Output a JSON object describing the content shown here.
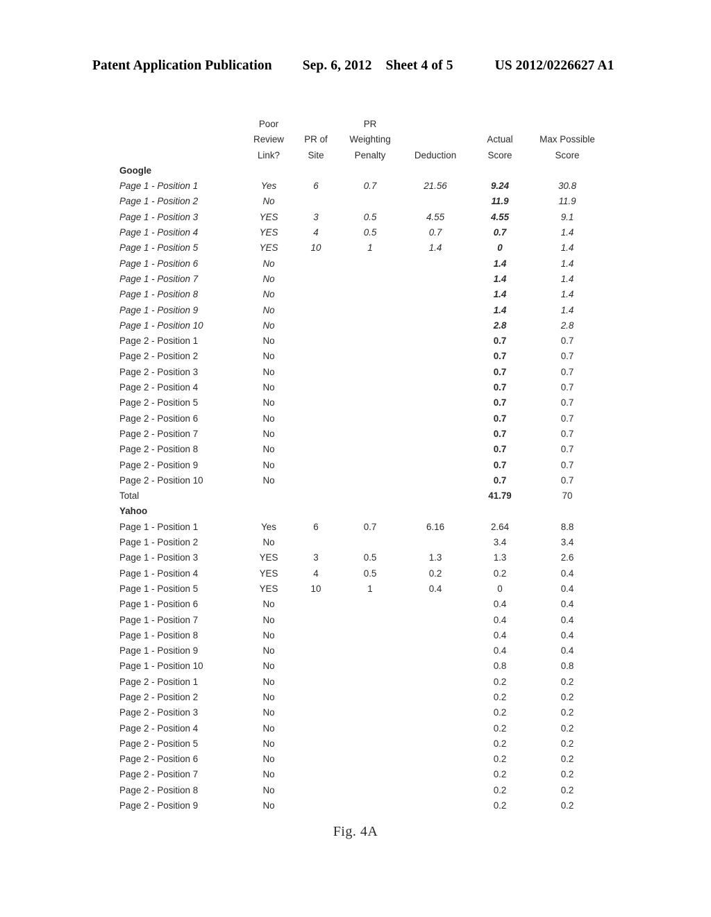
{
  "patent_header": {
    "publication": "Patent Application Publication",
    "date": "Sep. 6, 2012",
    "sheet": "Sheet 4 of 5",
    "publication_number": "US 2012/0226627 A1"
  },
  "figure": {
    "caption": "Fig. 4A"
  },
  "table": {
    "columns": [
      {
        "key": "label",
        "header_lines": [
          "",
          "",
          ""
        ]
      },
      {
        "key": "poor_review",
        "header_lines": [
          "Poor",
          "Review",
          "Link?"
        ]
      },
      {
        "key": "pr_of_site",
        "header_lines": [
          "",
          "PR of",
          "Site"
        ]
      },
      {
        "key": "pr_weight",
        "header_lines": [
          "PR",
          "Weighting",
          "Penalty"
        ]
      },
      {
        "key": "deduction",
        "header_lines": [
          "",
          "",
          "Deduction"
        ]
      },
      {
        "key": "actual",
        "header_lines": [
          "",
          "Actual",
          "Score"
        ]
      },
      {
        "key": "max",
        "header_lines": [
          "",
          "Max Possible",
          "Score"
        ]
      }
    ],
    "rows": [
      {
        "style": "section",
        "label": "Google",
        "poor_review": "",
        "pr_of_site": "",
        "pr_weight": "",
        "deduction": "",
        "actual": "",
        "max": ""
      },
      {
        "style": "italic",
        "bold_actual": true,
        "label": "Page 1 - Position 1",
        "poor_review": "Yes",
        "pr_of_site": "6",
        "pr_weight": "0.7",
        "deduction": "21.56",
        "actual": "9.24",
        "max": "30.8"
      },
      {
        "style": "italic",
        "bold_actual": true,
        "label": "Page 1 - Position 2",
        "poor_review": "No",
        "pr_of_site": "",
        "pr_weight": "",
        "deduction": "",
        "actual": "11.9",
        "max": "11.9"
      },
      {
        "style": "italic",
        "bold_actual": true,
        "label": "Page 1 - Position 3",
        "poor_review": "YES",
        "pr_of_site": "3",
        "pr_weight": "0.5",
        "deduction": "4.55",
        "actual": "4.55",
        "max": "9.1"
      },
      {
        "style": "italic",
        "bold_actual": true,
        "label": "Page 1 - Position 4",
        "poor_review": "YES",
        "pr_of_site": "4",
        "pr_weight": "0.5",
        "deduction": "0.7",
        "actual": "0.7",
        "max": "1.4"
      },
      {
        "style": "italic",
        "bold_actual": true,
        "label": "Page 1 - Position 5",
        "poor_review": "YES",
        "pr_of_site": "10",
        "pr_weight": "1",
        "deduction": "1.4",
        "actual": "0",
        "max": "1.4"
      },
      {
        "style": "italic",
        "bold_actual": true,
        "label": "Page 1 - Position 6",
        "poor_review": "No",
        "pr_of_site": "",
        "pr_weight": "",
        "deduction": "",
        "actual": "1.4",
        "max": "1.4"
      },
      {
        "style": "italic",
        "bold_actual": true,
        "label": "Page 1 - Position 7",
        "poor_review": "No",
        "pr_of_site": "",
        "pr_weight": "",
        "deduction": "",
        "actual": "1.4",
        "max": "1.4"
      },
      {
        "style": "italic",
        "bold_actual": true,
        "label": "Page 1 - Position 8",
        "poor_review": "No",
        "pr_of_site": "",
        "pr_weight": "",
        "deduction": "",
        "actual": "1.4",
        "max": "1.4"
      },
      {
        "style": "italic",
        "bold_actual": true,
        "label": "Page 1 - Position 9",
        "poor_review": "No",
        "pr_of_site": "",
        "pr_weight": "",
        "deduction": "",
        "actual": "1.4",
        "max": "1.4"
      },
      {
        "style": "italic",
        "bold_actual": true,
        "label": "Page 1 - Position 10",
        "poor_review": "No",
        "pr_of_site": "",
        "pr_weight": "",
        "deduction": "",
        "actual": "2.8",
        "max": "2.8"
      },
      {
        "style": "plain",
        "bold_actual": true,
        "label": "Page 2 - Position 1",
        "poor_review": "No",
        "pr_of_site": "",
        "pr_weight": "",
        "deduction": "",
        "actual": "0.7",
        "max": "0.7"
      },
      {
        "style": "plain",
        "bold_actual": true,
        "label": "Page 2 - Position 2",
        "poor_review": "No",
        "pr_of_site": "",
        "pr_weight": "",
        "deduction": "",
        "actual": "0.7",
        "max": "0.7"
      },
      {
        "style": "plain",
        "bold_actual": true,
        "label": "Page 2 - Position 3",
        "poor_review": "No",
        "pr_of_site": "",
        "pr_weight": "",
        "deduction": "",
        "actual": "0.7",
        "max": "0.7"
      },
      {
        "style": "plain",
        "bold_actual": true,
        "label": "Page 2 - Position 4",
        "poor_review": "No",
        "pr_of_site": "",
        "pr_weight": "",
        "deduction": "",
        "actual": "0.7",
        "max": "0.7"
      },
      {
        "style": "plain",
        "bold_actual": true,
        "label": "Page 2 - Position 5",
        "poor_review": "No",
        "pr_of_site": "",
        "pr_weight": "",
        "deduction": "",
        "actual": "0.7",
        "max": "0.7"
      },
      {
        "style": "plain",
        "bold_actual": true,
        "label": "Page 2 - Position 6",
        "poor_review": "No",
        "pr_of_site": "",
        "pr_weight": "",
        "deduction": "",
        "actual": "0.7",
        "max": "0.7"
      },
      {
        "style": "plain",
        "bold_actual": true,
        "label": "Page 2 - Position 7",
        "poor_review": "No",
        "pr_of_site": "",
        "pr_weight": "",
        "deduction": "",
        "actual": "0.7",
        "max": "0.7"
      },
      {
        "style": "plain",
        "bold_actual": true,
        "label": "Page 2 - Position 8",
        "poor_review": "No",
        "pr_of_site": "",
        "pr_weight": "",
        "deduction": "",
        "actual": "0.7",
        "max": "0.7"
      },
      {
        "style": "plain",
        "bold_actual": true,
        "label": "Page 2 - Position 9",
        "poor_review": "No",
        "pr_of_site": "",
        "pr_weight": "",
        "deduction": "",
        "actual": "0.7",
        "max": "0.7"
      },
      {
        "style": "plain",
        "bold_actual": true,
        "label": "Page 2 - Position 10",
        "poor_review": "No",
        "pr_of_site": "",
        "pr_weight": "",
        "deduction": "",
        "actual": "0.7",
        "max": "0.7"
      },
      {
        "style": "plain",
        "bold_actual": true,
        "label": "Total",
        "poor_review": "",
        "pr_of_site": "",
        "pr_weight": "",
        "deduction": "",
        "actual": "41.79",
        "max": "70"
      },
      {
        "style": "section",
        "label": "Yahoo",
        "poor_review": "",
        "pr_of_site": "",
        "pr_weight": "",
        "deduction": "",
        "actual": "",
        "max": ""
      },
      {
        "style": "plain",
        "label": "Page 1 - Position 1",
        "poor_review": "Yes",
        "pr_of_site": "6",
        "pr_weight": "0.7",
        "deduction": "6.16",
        "actual": "2.64",
        "max": "8.8"
      },
      {
        "style": "plain",
        "label": "Page 1 - Position 2",
        "poor_review": "No",
        "pr_of_site": "",
        "pr_weight": "",
        "deduction": "",
        "actual": "3.4",
        "max": "3.4"
      },
      {
        "style": "plain",
        "label": "Page 1 - Position 3",
        "poor_review": "YES",
        "pr_of_site": "3",
        "pr_weight": "0.5",
        "deduction": "1.3",
        "actual": "1.3",
        "max": "2.6"
      },
      {
        "style": "plain",
        "label": "Page 1 - Position 4",
        "poor_review": "YES",
        "pr_of_site": "4",
        "pr_weight": "0.5",
        "deduction": "0.2",
        "actual": "0.2",
        "max": "0.4"
      },
      {
        "style": "plain",
        "label": "Page 1 - Position 5",
        "poor_review": "YES",
        "pr_of_site": "10",
        "pr_weight": "1",
        "deduction": "0.4",
        "actual": "0",
        "max": "0.4"
      },
      {
        "style": "plain",
        "label": "Page 1 - Position 6",
        "poor_review": "No",
        "pr_of_site": "",
        "pr_weight": "",
        "deduction": "",
        "actual": "0.4",
        "max": "0.4"
      },
      {
        "style": "plain",
        "label": "Page 1 - Position 7",
        "poor_review": "No",
        "pr_of_site": "",
        "pr_weight": "",
        "deduction": "",
        "actual": "0.4",
        "max": "0.4"
      },
      {
        "style": "plain",
        "label": "Page 1 - Position 8",
        "poor_review": "No",
        "pr_of_site": "",
        "pr_weight": "",
        "deduction": "",
        "actual": "0.4",
        "max": "0.4"
      },
      {
        "style": "plain",
        "label": "Page 1 - Position 9",
        "poor_review": "No",
        "pr_of_site": "",
        "pr_weight": "",
        "deduction": "",
        "actual": "0.4",
        "max": "0.4"
      },
      {
        "style": "plain",
        "label": "Page 1 - Position 10",
        "poor_review": "No",
        "pr_of_site": "",
        "pr_weight": "",
        "deduction": "",
        "actual": "0.8",
        "max": "0.8"
      },
      {
        "style": "plain",
        "label": "Page 2 - Position 1",
        "poor_review": "No",
        "pr_of_site": "",
        "pr_weight": "",
        "deduction": "",
        "actual": "0.2",
        "max": "0.2"
      },
      {
        "style": "plain",
        "label": "Page 2 - Position 2",
        "poor_review": "No",
        "pr_of_site": "",
        "pr_weight": "",
        "deduction": "",
        "actual": "0.2",
        "max": "0.2"
      },
      {
        "style": "plain",
        "label": "Page 2 - Position 3",
        "poor_review": "No",
        "pr_of_site": "",
        "pr_weight": "",
        "deduction": "",
        "actual": "0.2",
        "max": "0.2"
      },
      {
        "style": "plain",
        "label": "Page 2 - Position 4",
        "poor_review": "No",
        "pr_of_site": "",
        "pr_weight": "",
        "deduction": "",
        "actual": "0.2",
        "max": "0.2"
      },
      {
        "style": "plain",
        "label": "Page 2 - Position 5",
        "poor_review": "No",
        "pr_of_site": "",
        "pr_weight": "",
        "deduction": "",
        "actual": "0.2",
        "max": "0.2"
      },
      {
        "style": "plain",
        "label": "Page 2 - Position 6",
        "poor_review": "No",
        "pr_of_site": "",
        "pr_weight": "",
        "deduction": "",
        "actual": "0.2",
        "max": "0.2"
      },
      {
        "style": "plain",
        "label": "Page 2 - Position 7",
        "poor_review": "No",
        "pr_of_site": "",
        "pr_weight": "",
        "deduction": "",
        "actual": "0.2",
        "max": "0.2"
      },
      {
        "style": "plain",
        "label": "Page 2 - Position 8",
        "poor_review": "No",
        "pr_of_site": "",
        "pr_weight": "",
        "deduction": "",
        "actual": "0.2",
        "max": "0.2"
      },
      {
        "style": "plain",
        "label": "Page 2 - Position 9",
        "poor_review": "No",
        "pr_of_site": "",
        "pr_weight": "",
        "deduction": "",
        "actual": "0.2",
        "max": "0.2"
      }
    ]
  }
}
